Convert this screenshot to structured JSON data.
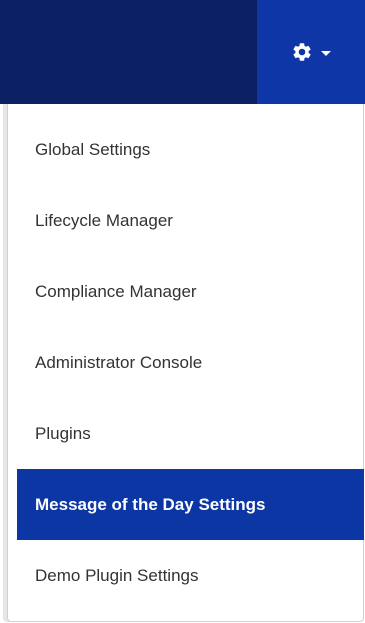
{
  "header": {
    "settings_icon": "gear-icon",
    "caret_icon": "caret-down-icon"
  },
  "colors": {
    "topbar": "#0b2163",
    "toggle": "#0f36a7",
    "active_item": "#0c36a3",
    "text": "#333333"
  },
  "menu": {
    "items": [
      {
        "label": "Global Settings",
        "active": false
      },
      {
        "label": "Lifecycle Manager",
        "active": false
      },
      {
        "label": "Compliance Manager",
        "active": false
      },
      {
        "label": "Administrator Console",
        "active": false
      },
      {
        "label": "Plugins",
        "active": false
      },
      {
        "label": "Message of the Day Settings",
        "active": true
      },
      {
        "label": "Demo Plugin Settings",
        "active": false
      }
    ]
  }
}
